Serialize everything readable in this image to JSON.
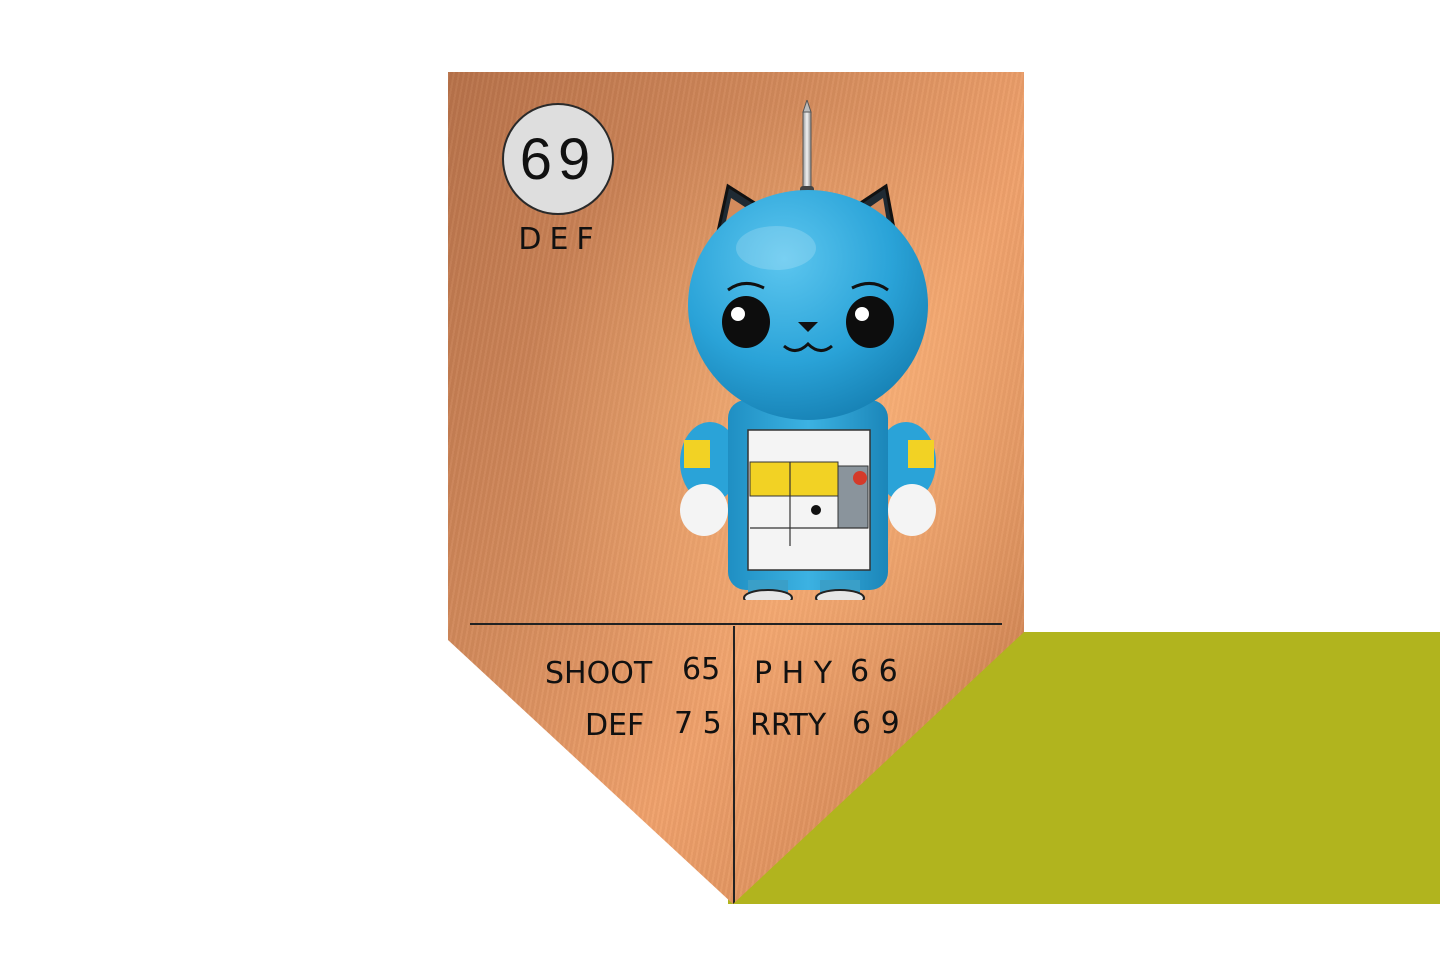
{
  "card": {
    "rating": "69",
    "position": "DEF",
    "stats": {
      "left": [
        {
          "label": "SHOOT",
          "value": "65"
        },
        {
          "label": "DEF",
          "value": "7 5"
        }
      ],
      "right": [
        {
          "label": "P H Y",
          "value": "6 6"
        },
        {
          "label": "RRTY",
          "value": "6 9"
        }
      ]
    }
  },
  "colors": {
    "card_bronze": "#d48b5c",
    "olive_block": "#b1b41e",
    "character_blue": "#2aa3d8"
  },
  "icons": [
    "cat-robot-figure"
  ]
}
